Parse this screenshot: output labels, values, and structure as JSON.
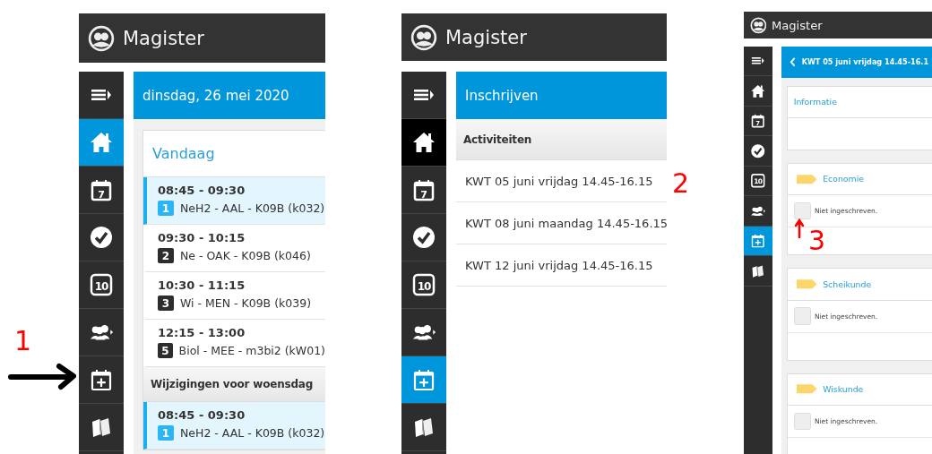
{
  "panels": [
    {
      "kind": "agenda",
      "app_title": "Magister",
      "sidebar": [
        {
          "kind": "menu",
          "selected": false,
          "highlighted": false
        },
        {
          "kind": "home",
          "selected": true,
          "highlighted": false
        },
        {
          "kind": "calendar",
          "label": "7",
          "selected": false,
          "highlighted": false
        },
        {
          "kind": "check",
          "selected": false,
          "highlighted": false
        },
        {
          "kind": "number",
          "label": "10",
          "selected": false,
          "highlighted": false
        },
        {
          "kind": "groups",
          "selected": false,
          "highlighted": false
        },
        {
          "kind": "calendar-plus",
          "selected": false,
          "highlighted": false
        },
        {
          "kind": "books",
          "selected": false,
          "highlighted": false
        }
      ],
      "header": "dinsdag, 26 mei 2020",
      "card_title": "Vandaag",
      "items": [
        {
          "kind": "lesson",
          "time": "08:45 - 09:30",
          "hour": "1",
          "text": "NeH2 - AAL - K09B (k032)",
          "highlighted": true
        },
        {
          "kind": "lesson",
          "time": "09:30 - 10:15",
          "hour": "2",
          "text": "Ne - OAK - K09B (k046)",
          "highlighted": false
        },
        {
          "kind": "lesson",
          "time": "10:30 - 11:15",
          "hour": "3",
          "text": "Wi - MEN - K09B (k039)",
          "highlighted": false
        },
        {
          "kind": "lesson",
          "time": "12:15 - 13:00",
          "hour": "5",
          "text": "Biol - MEE - m3bi2 (kW01)",
          "highlighted": false
        },
        {
          "kind": "heading",
          "text": "Wijzigingen voor woensdag"
        },
        {
          "kind": "lesson",
          "time": "08:45 - 09:30",
          "hour": "1",
          "text": "NeH2 - AAL - K09B (k032)",
          "highlighted": true
        }
      ]
    },
    {
      "kind": "list",
      "app_title": "Magister",
      "sidebar": [
        {
          "kind": "menu",
          "selected": false,
          "highlighted": false
        },
        {
          "kind": "home",
          "selected": false,
          "highlighted": true
        },
        {
          "kind": "calendar",
          "label": "7",
          "selected": false,
          "highlighted": false
        },
        {
          "kind": "check",
          "selected": false,
          "highlighted": false
        },
        {
          "kind": "number",
          "label": "10",
          "selected": false,
          "highlighted": false
        },
        {
          "kind": "groups",
          "selected": false,
          "highlighted": false
        },
        {
          "kind": "calendar-plus",
          "selected": true,
          "highlighted": false
        },
        {
          "kind": "books",
          "selected": false,
          "highlighted": false
        }
      ],
      "header": "Inschrijven",
      "section": "Activiteiten",
      "rows": [
        "KWT 05 juni vrijdag 14.45-16.15",
        "KWT 08 juni maandag 14.45-16.15",
        "KWT 12 juni vrijdag 14.45-16.15"
      ]
    },
    {
      "kind": "detail",
      "app_title": "Magister",
      "sidebar": [
        {
          "kind": "menu",
          "selected": false,
          "highlighted": false
        },
        {
          "kind": "home",
          "selected": false,
          "highlighted": false
        },
        {
          "kind": "calendar",
          "label": "7",
          "selected": false,
          "highlighted": false
        },
        {
          "kind": "check",
          "selected": false,
          "highlighted": false
        },
        {
          "kind": "number",
          "label": "10",
          "selected": false,
          "highlighted": false
        },
        {
          "kind": "groups",
          "selected": false,
          "highlighted": false
        },
        {
          "kind": "calendar-plus",
          "selected": true,
          "highlighted": false
        },
        {
          "kind": "books",
          "selected": false,
          "highlighted": false
        }
      ],
      "header": "KWT 05 juni vrijdag 14.45-16.1",
      "cards": [
        {
          "kind": "info",
          "title": "Informatie"
        },
        {
          "kind": "subject",
          "title": "Economie",
          "checked": false,
          "label": "Niet ingeschreven."
        },
        {
          "kind": "subject",
          "title": "Scheikunde",
          "checked": false,
          "label": "Niet ingeschreven."
        },
        {
          "kind": "subject",
          "title": "Wiskunde",
          "checked": false,
          "label": "Niet ingeschreven."
        }
      ]
    }
  ],
  "annotations": [
    {
      "kind": "label",
      "text": "1",
      "color": "#ff0000"
    },
    {
      "kind": "arrow",
      "color": "#000000"
    },
    {
      "kind": "label",
      "text": "2",
      "color": "#ff0000"
    },
    {
      "kind": "arrow",
      "color": "#ff0000"
    },
    {
      "kind": "label",
      "text": "3",
      "color": "#ff0000"
    }
  ]
}
